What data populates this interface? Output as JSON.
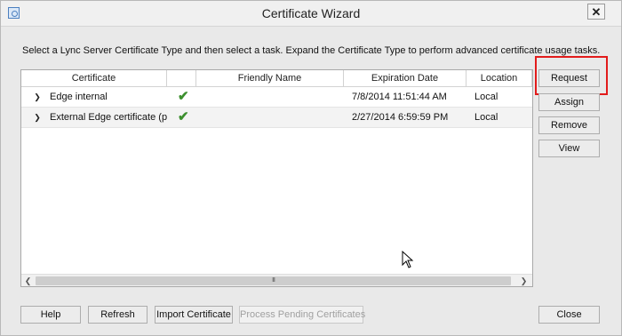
{
  "window": {
    "title": "Certificate Wizard",
    "close_symbol": "✕"
  },
  "instruction": "Select a Lync Server Certificate Type and then select a task. Expand the Certificate Type to perform advanced certificate usage tasks.",
  "grid": {
    "columns": [
      "Certificate",
      "",
      "Friendly Name",
      "Expiration Date",
      "Location"
    ],
    "rows": [
      {
        "certificate": "Edge internal",
        "status_icon": "check-icon",
        "friendly_name": "",
        "expiration_date": "7/8/2014 11:51:44 AM",
        "location": "Local"
      },
      {
        "certificate": "External Edge certificate (pu",
        "status_icon": "check-icon",
        "friendly_name": "",
        "expiration_date": "2/27/2014 6:59:59 PM",
        "location": "Local"
      }
    ],
    "scroll_thumb_glyph": "III"
  },
  "side_buttons": {
    "request": "Request",
    "assign": "Assign",
    "remove": "Remove",
    "view": "View"
  },
  "bottom_buttons": {
    "help": "Help",
    "refresh": "Refresh",
    "import": "Import Certificate",
    "process_pending": "Process Pending Certificates",
    "close": "Close"
  },
  "colors": {
    "highlight": "#e21b1b",
    "check": "#3c8f2e"
  }
}
